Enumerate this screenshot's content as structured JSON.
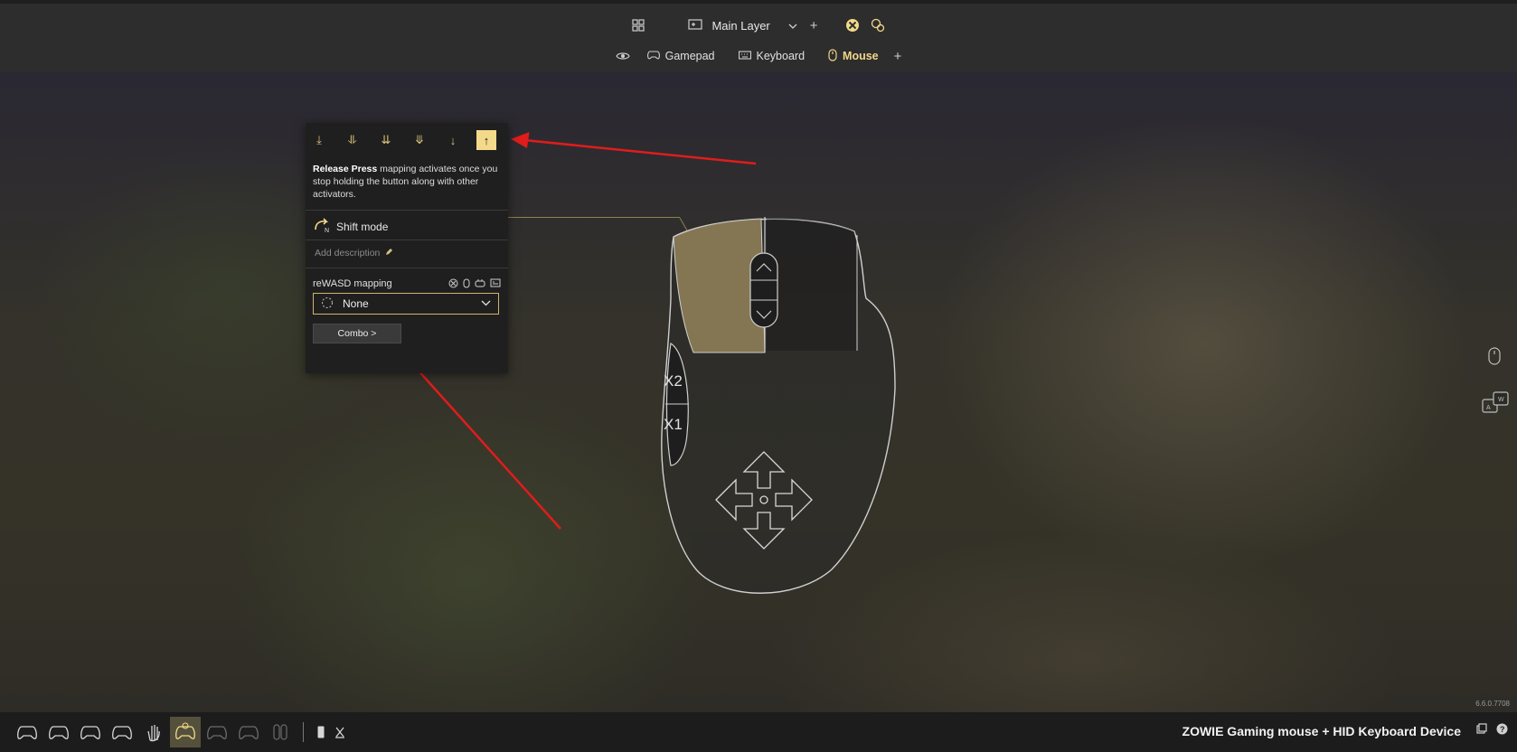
{
  "header": {
    "layer_label": "Main Layer",
    "tabs": [
      {
        "label": "Gamepad",
        "icon": "gamepad-icon"
      },
      {
        "label": "Keyboard",
        "icon": "keyboard-icon"
      },
      {
        "label": "Mouse",
        "icon": "mouse-icon",
        "active": true
      }
    ]
  },
  "panel": {
    "modes": [
      "start-press-icon",
      "long-press-icon",
      "double-press-icon",
      "triple-press-icon",
      "press-icon",
      "release-press-icon"
    ],
    "active_mode": "release-press-icon",
    "desc_bold": "Release Press",
    "desc_rest": " mapping activates once you stop holding the button along with other activators.",
    "shift_mode_label": "Shift mode",
    "add_description_label": "Add description",
    "mapping_label": "reWASD mapping",
    "selected_mapping": "None",
    "combo_label": "Combo >"
  },
  "mouse": {
    "x2_label": "X2",
    "x1_label": "X1"
  },
  "version": "6.6.0.7708",
  "footer": {
    "device_name": "ZOWIE Gaming mouse + HID Keyboard Device"
  },
  "colors": {
    "accent": "#f3d98a",
    "highlight_zone": "#8c7d57",
    "arrow": "#e01c1c"
  }
}
